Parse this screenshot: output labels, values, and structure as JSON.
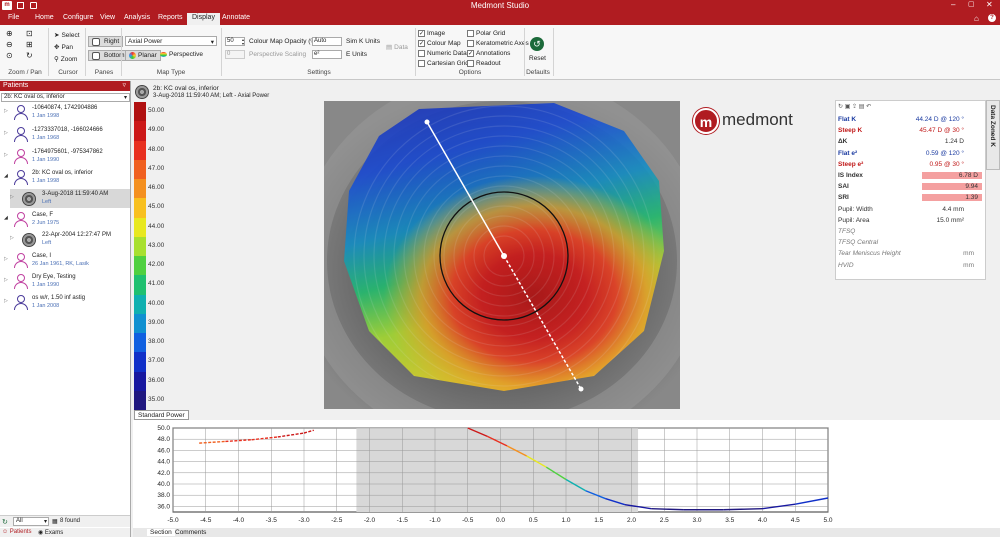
{
  "app": {
    "title": "Medmont Studio"
  },
  "menu": [
    "File",
    "Home",
    "Configure",
    "View",
    "Analysis",
    "Reports",
    "Display",
    "Annotate"
  ],
  "ribbon": {
    "groups": {
      "zoom": "Zoom / Pan",
      "cursor": "Cursor",
      "panes": "Panes",
      "maptype": "Map Type",
      "settings": "Settings",
      "options": "Options",
      "defaults": "Defaults"
    },
    "cursor": {
      "select": "Select",
      "pan": "Pan",
      "zoom": "Zoom"
    },
    "panes": {
      "right": "Right",
      "bottom": "Bottom"
    },
    "maptype": {
      "selected": "Axial Power",
      "planar": "Planar",
      "perspective": "Perspective"
    },
    "settings": {
      "opacity_value": "50",
      "opacity_label": "Colour Map Opacity (%)",
      "auto": "Auto",
      "simk": "Sim K Units",
      "scaling_value": "0",
      "scaling_label": "Perspective Scaling",
      "e2": "e²",
      "eunits": "E Units",
      "data": "Data"
    },
    "options": {
      "image": "Image",
      "colour_map": "Colour Map",
      "numeric_data": "Numeric Data",
      "cartesian_grid": "Cartesian Grid",
      "polar_grid": "Polar Grid",
      "keratometric_axes": "Keratometric Axes",
      "annotations": "Annotations",
      "readout": "Readout"
    },
    "reset": "Reset"
  },
  "patients": {
    "header": "Patients",
    "selected": "2b: KC oval os, inferior",
    "items": [
      {
        "n1": "-10640874, 1742904886",
        "n2": "1 Jan 1998",
        "g": "m"
      },
      {
        "n1": "-1273337018, -166024666",
        "n2": "1 Jan 1968",
        "g": "m"
      },
      {
        "n1": "-1764975601, -975347862",
        "n2": "1 Jan 1990",
        "g": "f"
      },
      {
        "n1": "2b: KC oval os, inferior",
        "n2": "1 Jan 1998",
        "g": "m"
      },
      {
        "n1": "3-Aug-2018 11:59:40 AM",
        "n2": "Left",
        "g": "exam"
      },
      {
        "n1": "Case, F",
        "n2": "2 Jun 1975",
        "g": "f"
      },
      {
        "n1": "22-Apr-2004 12:27:47 PM",
        "n2": "Left",
        "g": "exam"
      },
      {
        "n1": "Case, I",
        "n2": "26 Jan 1961, RK, Lasik",
        "g": "f"
      },
      {
        "n1": "Dry Eye, Testing",
        "n2": "1 Jan 1990",
        "g": "f"
      },
      {
        "n1": "os w/r, 1.50 inf astig",
        "n2": "1 Jan 2008",
        "g": "m"
      }
    ],
    "filter": "All",
    "found": "8 found",
    "tabs": [
      "Patients",
      "Exams"
    ]
  },
  "map": {
    "title": "2b: KC oval os, inferior",
    "subtitle": "3-Aug-2018 11:59:40 AM; Left - Axial Power",
    "scale": [
      "50.00",
      "49.00",
      "48.00",
      "47.00",
      "46.00",
      "45.00",
      "44.00",
      "43.00",
      "42.00",
      "41.00",
      "40.00",
      "39.00",
      "38.00",
      "37.00",
      "36.00",
      "35.00"
    ],
    "scale_colors": [
      "#b01010",
      "#cc1818",
      "#e83020",
      "#f06020",
      "#f49020",
      "#f8c020",
      "#e8e820",
      "#a8e030",
      "#50d040",
      "#20c070",
      "#10b0b0",
      "#1090d0",
      "#1060e0",
      "#1030c8",
      "#1818a0",
      "#201880"
    ],
    "logo": "medmont",
    "standard_power": "Standard Power"
  },
  "values": [
    {
      "k": "Flat K",
      "v": "44.24 D @ 120 °",
      "c": "#1a3aa0"
    },
    {
      "k": "Steep K",
      "v": "45.47 D @ 30 °",
      "c": "#c01818"
    },
    {
      "k": "ΔK",
      "v": "1.24 D",
      "c": "#333"
    },
    {
      "k": "Flat e²",
      "v": "0.59 @ 120 °",
      "c": "#1a3aa0"
    },
    {
      "k": "Steep e²",
      "v": "0.95 @ 30 °",
      "c": "#c01818"
    },
    {
      "k": "IS Index",
      "v": "6.78 D",
      "c": "#333",
      "hl": true
    },
    {
      "k": "SAI",
      "v": "9.94",
      "c": "#333",
      "hl": true
    },
    {
      "k": "SRI",
      "v": "1.39",
      "c": "#333",
      "hl": true
    },
    {
      "k": "Pupil: Width",
      "v": "4.4 mm",
      "c": "#333"
    },
    {
      "k": "Pupil: Area",
      "v": "15.0 mm²",
      "c": "#333"
    },
    {
      "k": "TFSQ",
      "v": "",
      "c": "#777"
    },
    {
      "k": "TFSQ Central",
      "v": "",
      "c": "#777"
    },
    {
      "k": "Tear Meniscus Height",
      "v": "mm",
      "c": "#777"
    },
    {
      "k": "HVID",
      "v": "mm",
      "c": "#777"
    }
  ],
  "sidetab": "Data Zoned K",
  "chart_data": {
    "type": "line",
    "x": [
      -4.6,
      -4.0,
      -3.5,
      -3.0,
      -2.5,
      2.0,
      -0.5,
      0.0,
      0.5,
      1.0,
      1.5,
      2.0,
      2.5,
      3.0,
      3.5,
      4.0,
      4.5,
      5.0
    ],
    "ylim": [
      35.0,
      50.0
    ],
    "xlim": [
      -5.0,
      5.0
    ],
    "yticks": [
      "50.0",
      "48.0",
      "46.0",
      "44.0",
      "42.0",
      "40.0",
      "38.0",
      "36.0"
    ],
    "xticks": [
      "-5.0",
      "-4.5",
      "-4.0",
      "-3.5",
      "-3.0",
      "-2.5",
      "-2.0",
      "-1.5",
      "-1.0",
      "-0.5",
      "0.0",
      "0.5",
      "1.0",
      "1.5",
      "2.0",
      "2.5",
      "3.0",
      "3.5",
      "4.0",
      "4.5",
      "5.0"
    ],
    "grid": true
  },
  "bottom_tabs": [
    "Section",
    "Comments"
  ]
}
